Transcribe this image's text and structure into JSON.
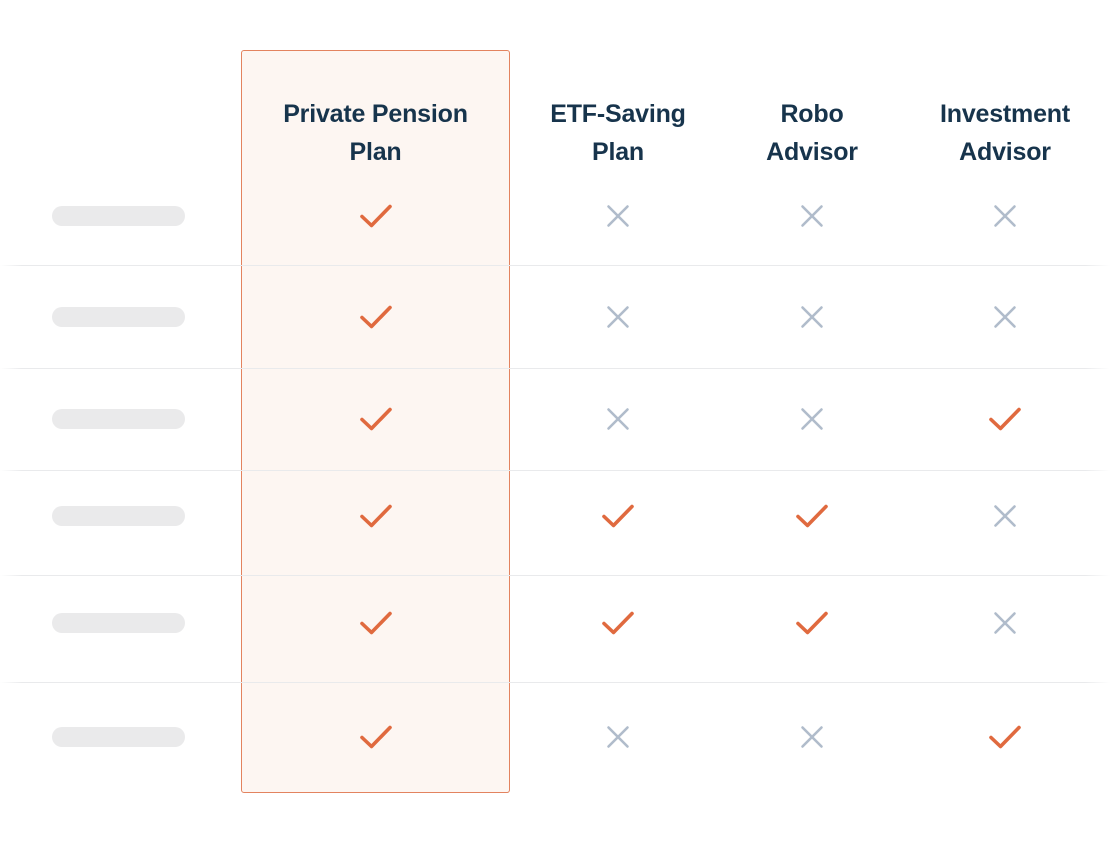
{
  "colors": {
    "accent": "#e06a3f",
    "accent_border": "#e3835f",
    "highlight_bg": "#fdf6f2",
    "heading_text": "#17344c",
    "cross": "#b0bccb",
    "skeleton": "#eaeaeb",
    "divider": "#e9eaec",
    "page_bg": "#ffffff"
  },
  "table": {
    "columns": [
      {
        "id": "private-pension-plan",
        "label": "Private Pension\nPlan",
        "featured": true
      },
      {
        "id": "etf-saving-plan",
        "label": "ETF-Saving\nPlan",
        "featured": false
      },
      {
        "id": "robo-advisor",
        "label": "Robo\nAdvisor",
        "featured": false
      },
      {
        "id": "investment-advisor",
        "label": "Investment\nAdvisor",
        "featured": false
      }
    ],
    "rows": [
      {
        "label": "",
        "label_placeholder": true,
        "values": [
          "check",
          "cross",
          "cross",
          "cross"
        ]
      },
      {
        "label": "",
        "label_placeholder": true,
        "values": [
          "check",
          "cross",
          "cross",
          "cross"
        ]
      },
      {
        "label": "",
        "label_placeholder": true,
        "values": [
          "check",
          "cross",
          "cross",
          "check"
        ]
      },
      {
        "label": "",
        "label_placeholder": true,
        "values": [
          "check",
          "check",
          "check",
          "cross"
        ]
      },
      {
        "label": "",
        "label_placeholder": true,
        "values": [
          "check",
          "check",
          "check",
          "cross"
        ]
      },
      {
        "label": "",
        "label_placeholder": true,
        "values": [
          "check",
          "cross",
          "cross",
          "check"
        ]
      }
    ],
    "icons": {
      "check": "check-icon",
      "cross": "cross-icon"
    },
    "row_tops": [
      190,
      293,
      395,
      490,
      597,
      712
    ],
    "row_icon_centers": [
      216,
      317,
      419,
      516,
      623,
      737
    ],
    "divider_tops": [
      265,
      368,
      470,
      575,
      682
    ]
  }
}
